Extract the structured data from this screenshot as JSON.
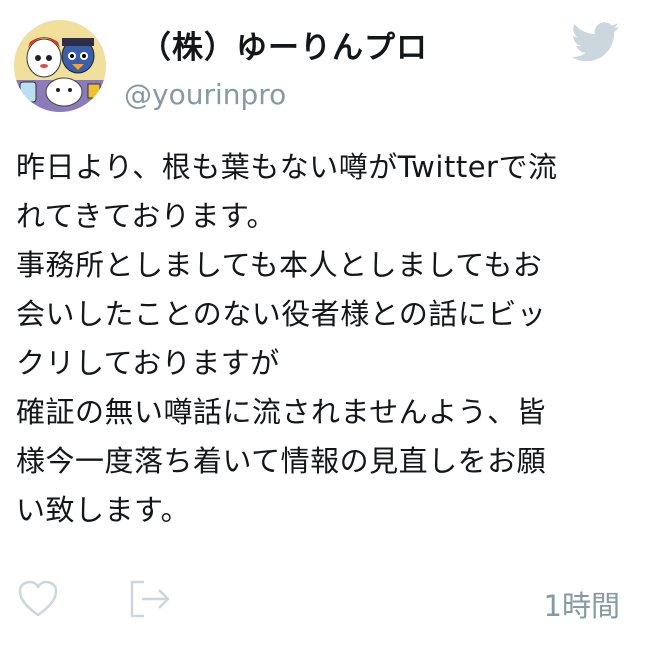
{
  "account": {
    "display_name": "（株）ゆーりんプロ",
    "handle": "@yourinpro"
  },
  "tweet": {
    "text": "昨日より、根も葉もない噂がTwitterで流\nれてきております。\n事務所としましても本人としましてもお\n会いしたことのない役者様との話にビッ\nクリしておりますが\n確証の無い噂話に流されませんよう、皆\n様今一度落ち着いて情報の見直しをお願\nい致します。",
    "timestamp": "1時間"
  },
  "icons": {
    "brand": "twitter-bird-icon",
    "like": "heart-icon",
    "share": "share-icon"
  },
  "colors": {
    "text": "#14171a",
    "muted": "#8899a6",
    "icon_gray": "#ccd6dd"
  }
}
